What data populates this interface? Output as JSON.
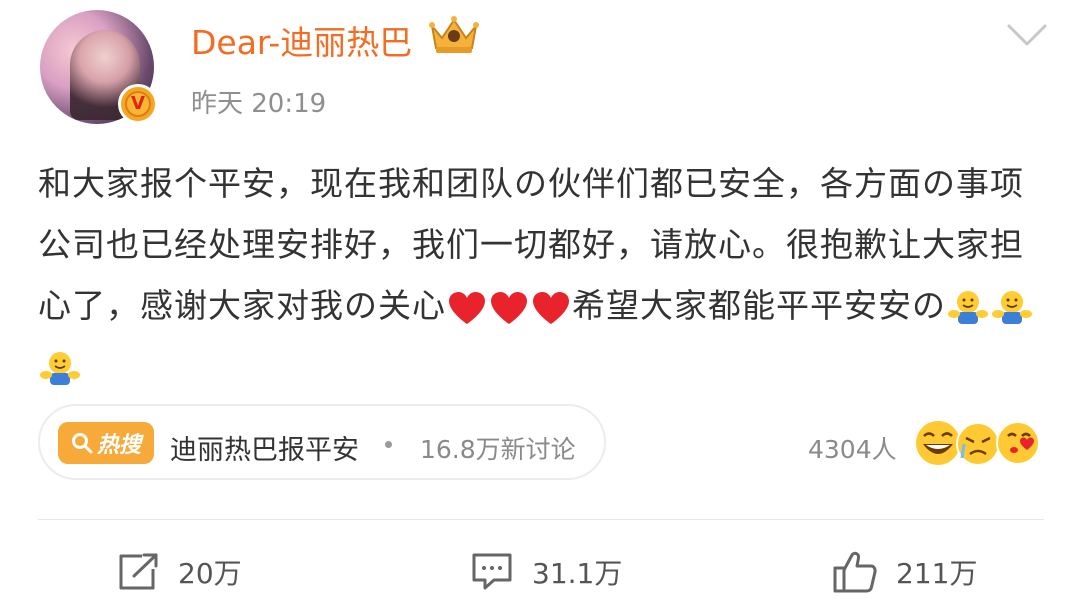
{
  "post": {
    "username": "Dear-迪丽热巴",
    "timestamp": "昨天 20:19",
    "verified_mark": "V",
    "body_text_1": "和大家报个平安，现在我和团队の伙伴们都已安全，各方面の事项公司也已经处理安排好，我们一切都好，请放心。很抱歉让大家担心了，感谢大家对我の关心",
    "body_text_2": "希望大家都能平平安安の"
  },
  "icons": {
    "crown": "vip-crown-badge-icon",
    "verified": "orange-v-verified-icon",
    "chevron": "chevron-down-icon",
    "heart": "red-heart-emoji",
    "hug": "hug-emoji",
    "repost": "repost-icon",
    "comment": "comment-icon",
    "like": "like-icon"
  },
  "topic": {
    "hot_label": "热搜",
    "title": "迪丽热巴报平安",
    "discussion": "16.8万新讨论"
  },
  "engagement": {
    "people_count": "4304人"
  },
  "actions": {
    "repost_count": "20万",
    "comment_count": "31.1万",
    "like_count": "211万"
  },
  "colors": {
    "brand_orange": "#f36c21",
    "hot_badge": "#f7a93a",
    "heart_red": "#e8232c",
    "text_gray": "#8f8f8f"
  }
}
